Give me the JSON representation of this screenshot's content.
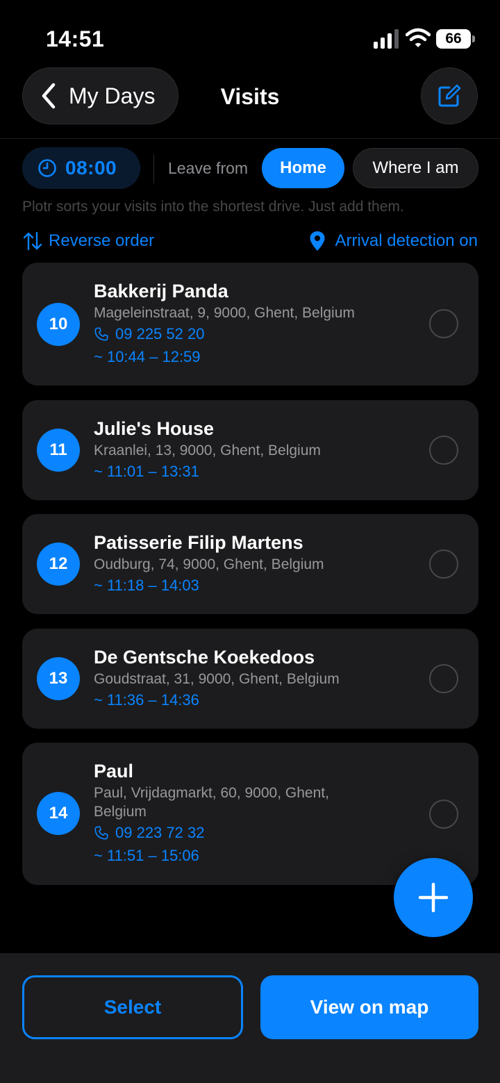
{
  "status_bar": {
    "time": "14:51",
    "battery": "66"
  },
  "nav": {
    "back_label": "My Days",
    "title": "Visits"
  },
  "controls": {
    "start_time": "08:00",
    "leave_from_label": "Leave from",
    "home_option": "Home",
    "current_location_option": "Where I am"
  },
  "helper_text": "Plotr sorts your visits into the shortest drive. Just add them.",
  "actions": {
    "reverse_label": "Reverse order",
    "arrival_label": "Arrival detection on"
  },
  "visits": [
    {
      "number": "10",
      "name": "Bakkerij Panda",
      "address": "Mageleinstraat, 9, 9000, Ghent, Belgium",
      "phone": "09 225 52 20",
      "window": "~ 10:44 – 12:59"
    },
    {
      "number": "11",
      "name": "Julie's House",
      "address": "Kraanlei, 13, 9000, Ghent, Belgium",
      "window": "~ 11:01 – 13:31"
    },
    {
      "number": "12",
      "name": "Patisserie Filip Martens",
      "address": "Oudburg, 74, 9000, Ghent, Belgium",
      "window": "~ 11:18 – 14:03"
    },
    {
      "number": "13",
      "name": "De Gentsche Koekedoos",
      "address": "Goudstraat, 31, 9000, Ghent, Belgium",
      "window": "~ 11:36 – 14:36"
    },
    {
      "number": "14",
      "name": "Paul",
      "address": "Paul, Vrijdagmarkt, 60, 9000, Ghent, Belgium",
      "phone": "09 223 72 32",
      "window": "~ 11:51 – 15:06"
    }
  ],
  "bottom": {
    "select_label": "Select",
    "map_label": "View on map"
  },
  "colors": {
    "accent": "#0a84ff",
    "background": "#000000",
    "card": "#1c1c1e"
  }
}
